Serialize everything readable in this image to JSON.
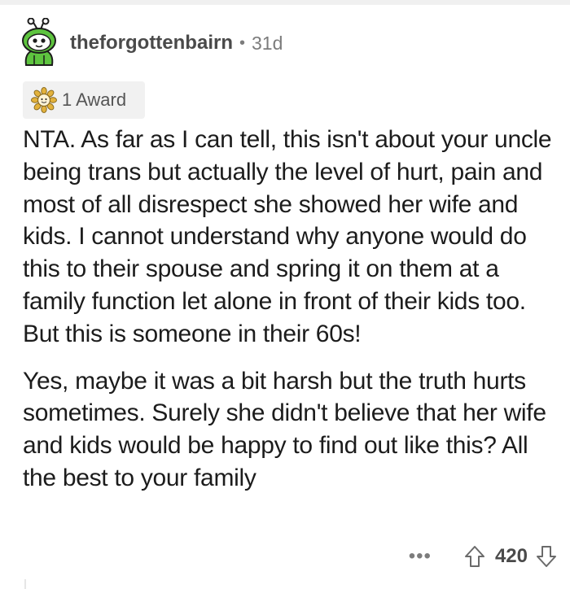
{
  "comment": {
    "username": "theforgottenbairn",
    "separator": "•",
    "age": "31d",
    "award": {
      "label": "1 Award",
      "icon": "sunflower-award-icon"
    },
    "paragraphs": [
      "NTA. As far as I can tell, this isn't about your uncle being trans but actually the level of hurt, pain and most of all disrespect she showed her wife and kids. I cannot understand why anyone would do this to their spouse and spring it on them at a family function let alone in front of their kids too. But this is someone in their 60s!",
      "Yes, maybe it was a bit harsh but the truth hurts sometimes.  Surely she didn't believe that her wife and kids would be happy to find out like this? All the best to your family"
    ],
    "more_label": "•••",
    "score": "420"
  },
  "colors": {
    "avatar_green": "#5ec43f",
    "award_bg": "#f1f1f1",
    "text": "#1c1c1c",
    "meta": "#7c7c7c"
  }
}
